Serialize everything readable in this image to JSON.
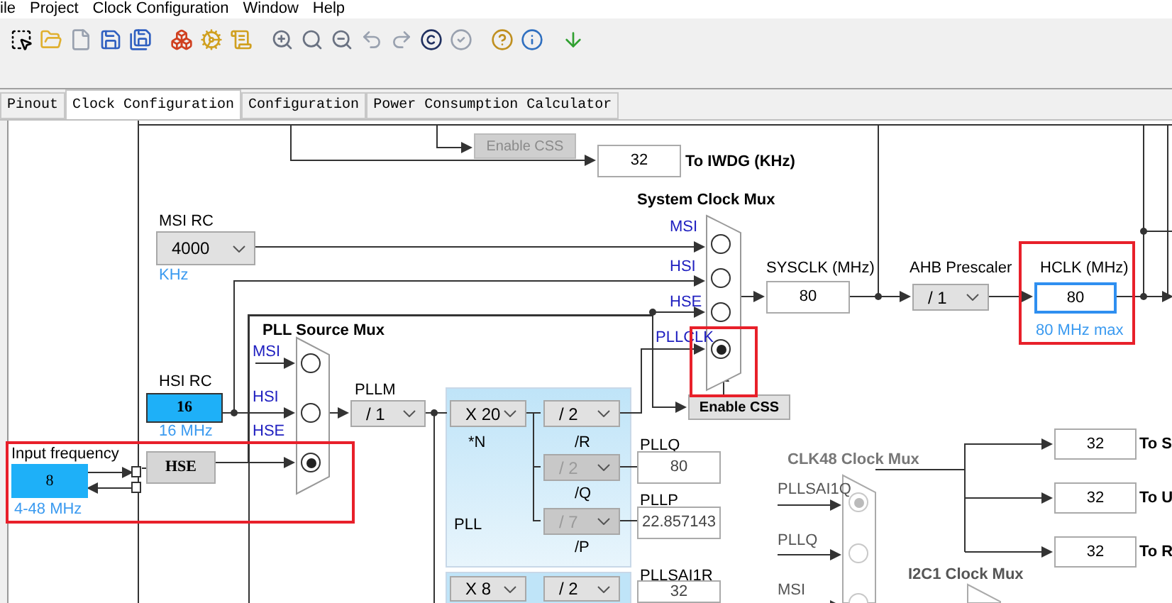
{
  "menu": [
    "ile",
    "Project",
    "Clock Configuration",
    "Window",
    "Help"
  ],
  "tabs": [
    {
      "label": "Pinout",
      "selected": false
    },
    {
      "label": "Clock Configuration",
      "selected": true
    },
    {
      "label": "Configuration",
      "selected": false
    },
    {
      "label": "Power Consumption Calculator",
      "selected": false
    }
  ],
  "watchdog": {
    "css_button": "Enable CSS",
    "css_disabled": true,
    "value": "32",
    "label": "To IWDG (KHz)"
  },
  "msi_rc": {
    "title": "MSI RC",
    "value": "4000",
    "unit": "KHz"
  },
  "hsi_rc": {
    "title": "HSI RC",
    "value": "16",
    "unit": "16 MHz"
  },
  "hse": {
    "title": "Input frequency",
    "value": "8",
    "range": "4-48 MHz",
    "label": "HSE"
  },
  "pll_source_mux": {
    "title": "PLL Source Mux",
    "inputs": [
      {
        "label": "MSI",
        "selected": false
      },
      {
        "label": "HSI",
        "selected": false
      },
      {
        "label": "HSE",
        "selected": true
      }
    ]
  },
  "pllm": {
    "title": "PLLM",
    "value": "/ 1"
  },
  "pll": {
    "title": "PLL",
    "n": {
      "value": "X 20",
      "label": "*N"
    },
    "dividers": [
      {
        "value": "/ 2",
        "label": "/R",
        "disabled": false
      },
      {
        "value": "/ 2",
        "label": "/Q",
        "disabled": true
      },
      {
        "value": "/ 7",
        "label": "/P",
        "disabled": true
      }
    ]
  },
  "pll_outputs": [
    {
      "label": "PLLQ",
      "value": "80"
    },
    {
      "label": "PLLP",
      "value": "22.857143"
    },
    {
      "label": "PLLSAI1R",
      "value": "32"
    }
  ],
  "pllsai1": {
    "n": "X 8",
    "divider": "/ 2"
  },
  "system_clock_mux": {
    "title": "System Clock Mux",
    "inputs": [
      {
        "label": "MSI",
        "selected": false
      },
      {
        "label": "HSI",
        "selected": false
      },
      {
        "label": "HSE",
        "selected": false
      },
      {
        "label": "PLLCLK",
        "selected": true
      }
    ],
    "css_button": "Enable CSS"
  },
  "sysclk": {
    "label": "SYSCLK (MHz)",
    "value": "80"
  },
  "ahb": {
    "label": "AHB Prescaler",
    "value": "/ 1"
  },
  "hclk": {
    "label": "HCLK (MHz)",
    "value": "80",
    "note": "80 MHz max"
  },
  "clk48_mux": {
    "title": "CLK48 Clock Mux",
    "disabled": true,
    "inputs": [
      {
        "label": "PLLSAI1Q",
        "selected": true
      },
      {
        "label": "PLLQ",
        "selected": false
      },
      {
        "label": "MSI",
        "selected": false
      }
    ]
  },
  "clk48_outputs": [
    {
      "value": "32",
      "label": "To S"
    },
    {
      "value": "32",
      "label": "To U"
    },
    {
      "value": "32",
      "label": "To R"
    }
  ],
  "i2c1_mux": {
    "title": "I2C1 Clock Mux"
  }
}
